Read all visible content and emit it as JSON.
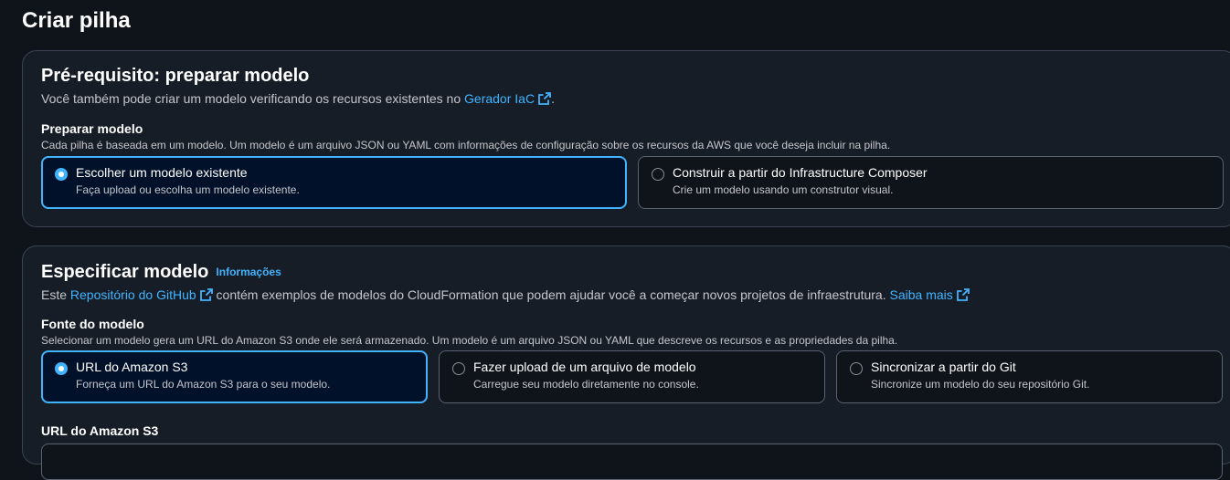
{
  "page": {
    "title": "Criar pilha"
  },
  "prereq": {
    "title": "Pré-requisito: preparar modelo",
    "desc_prefix": "Você também pode criar um modelo verificando os recursos existentes no",
    "desc_link": "Gerador IaC",
    "desc_suffix": ".",
    "field_label": "Preparar modelo",
    "field_desc": "Cada pilha é baseada em um modelo. Um modelo é um arquivo JSON ou YAML com informações de configuração sobre os recursos da AWS que você deseja incluir na pilha.",
    "options": [
      {
        "label": "Escolher um modelo existente",
        "desc": "Faça upload ou escolha um modelo existente.",
        "selected": true
      },
      {
        "label": "Construir a partir do Infrastructure Composer",
        "desc": "Crie um modelo usando um construtor visual.",
        "selected": false
      }
    ]
  },
  "spec": {
    "title": "Especificar modelo",
    "info_link": "Informações",
    "desc_prefix": "Este",
    "desc_link1": "Repositório do GitHub",
    "desc_middle": "contém exemplos de modelos do CloudFormation que podem ajudar você a começar novos projetos de infraestrutura.",
    "desc_link2": "Saiba mais",
    "field_label": "Fonte do modelo",
    "field_desc": "Selecionar um modelo gera um URL do Amazon S3 onde ele será armazenado. Um modelo é um arquivo JSON ou YAML que descreve os recursos e as propriedades da pilha.",
    "options": [
      {
        "label": "URL do Amazon S3",
        "desc": "Forneça um URL do Amazon S3 para o seu modelo.",
        "selected": true
      },
      {
        "label": "Fazer upload de um arquivo de modelo",
        "desc": "Carregue seu modelo diretamente no console.",
        "selected": false
      },
      {
        "label": "Sincronizar a partir do Git",
        "desc": "Sincronize um modelo do seu repositório Git.",
        "selected": false
      }
    ],
    "s3_label": "URL do Amazon S3"
  },
  "icons": {
    "external": "external-link-icon"
  },
  "colors": {
    "accent": "#42b4ff",
    "background": "#0f141a",
    "container": "#161d26",
    "selected_tile": "#001129"
  }
}
